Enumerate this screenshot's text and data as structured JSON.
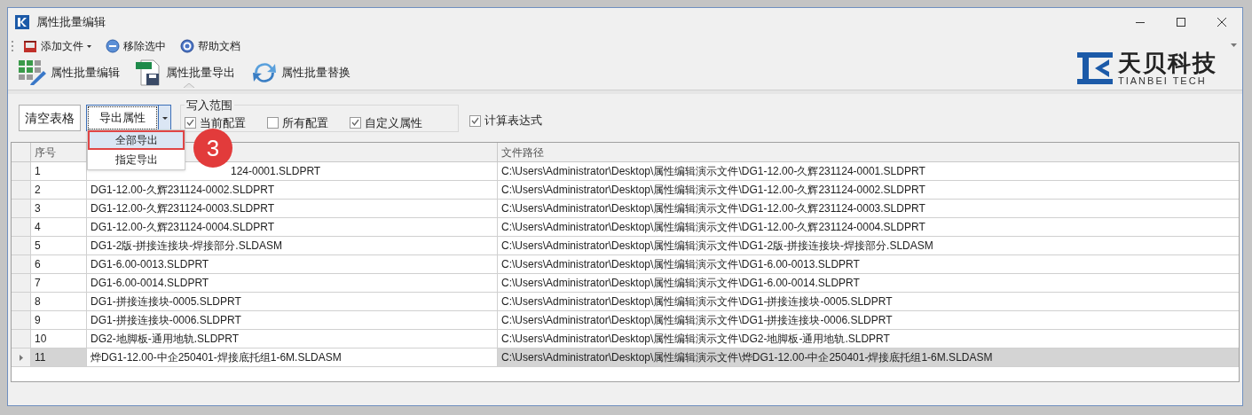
{
  "window": {
    "title": "属性批量编辑"
  },
  "toolbar": [
    {
      "label": "添加文件",
      "kind": "dropdown"
    },
    {
      "label": "移除选中",
      "kind": "remove"
    },
    {
      "label": "帮助文档",
      "kind": "help"
    }
  ],
  "ribbon": [
    {
      "label": "属性批量编辑",
      "kind": "grid",
      "selected": false
    },
    {
      "label": "属性批量导出",
      "kind": "xlsx",
      "selected": true
    },
    {
      "label": "属性批量替换",
      "kind": "refresh",
      "selected": false
    }
  ],
  "logo": {
    "name": "天贝科技",
    "subtitle": "TIANBEI TECH"
  },
  "actions": {
    "clear": "清空表格",
    "export": "导出属性"
  },
  "write_scope": {
    "title": "写入范围",
    "options": [
      {
        "label": "当前配置",
        "checked": true
      },
      {
        "label": "所有配置",
        "checked": false
      },
      {
        "label": "自定义属性",
        "checked": true
      }
    ]
  },
  "compute_expressions": {
    "label": "计算表达式",
    "checked": true
  },
  "export_menu": {
    "items": [
      {
        "label": "全部导出",
        "selected": true
      },
      {
        "label": "指定导出",
        "selected": false
      }
    ],
    "step_badge": "3"
  },
  "table": {
    "columns": [
      "序号",
      "文件路径"
    ],
    "rows": [
      {
        "index": "1",
        "name": "124-0001.SLDPRT",
        "path": "C:\\Users\\Administrator\\Desktop\\属性编辑演示文件\\DG1-12.00-久辉231124-0001.SLDPRT",
        "selected": false
      },
      {
        "index": "2",
        "name": "DG1-12.00-久辉231124-0002.SLDPRT",
        "path": "C:\\Users\\Administrator\\Desktop\\属性编辑演示文件\\DG1-12.00-久辉231124-0002.SLDPRT",
        "selected": false
      },
      {
        "index": "3",
        "name": "DG1-12.00-久辉231124-0003.SLDPRT",
        "path": "C:\\Users\\Administrator\\Desktop\\属性编辑演示文件\\DG1-12.00-久辉231124-0003.SLDPRT",
        "selected": false
      },
      {
        "index": "4",
        "name": "DG1-12.00-久辉231124-0004.SLDPRT",
        "path": "C:\\Users\\Administrator\\Desktop\\属性编辑演示文件\\DG1-12.00-久辉231124-0004.SLDPRT",
        "selected": false
      },
      {
        "index": "5",
        "name": "DG1-2版-拼接连接块-焊接部分.SLDASM",
        "path": "C:\\Users\\Administrator\\Desktop\\属性编辑演示文件\\DG1-2版-拼接连接块-焊接部分.SLDASM",
        "selected": false
      },
      {
        "index": "6",
        "name": "DG1-6.00-0013.SLDPRT",
        "path": "C:\\Users\\Administrator\\Desktop\\属性编辑演示文件\\DG1-6.00-0013.SLDPRT",
        "selected": false
      },
      {
        "index": "7",
        "name": "DG1-6.00-0014.SLDPRT",
        "path": "C:\\Users\\Administrator\\Desktop\\属性编辑演示文件\\DG1-6.00-0014.SLDPRT",
        "selected": false
      },
      {
        "index": "8",
        "name": "DG1-拼接连接块-0005.SLDPRT",
        "path": "C:\\Users\\Administrator\\Desktop\\属性编辑演示文件\\DG1-拼接连接块-0005.SLDPRT",
        "selected": false
      },
      {
        "index": "9",
        "name": "DG1-拼接连接块-0006.SLDPRT",
        "path": "C:\\Users\\Administrator\\Desktop\\属性编辑演示文件\\DG1-拼接连接块-0006.SLDPRT",
        "selected": false
      },
      {
        "index": "10",
        "name": "DG2-地脚板-通用地轨.SLDPRT",
        "path": "C:\\Users\\Administrator\\Desktop\\属性编辑演示文件\\DG2-地脚板-通用地轨.SLDPRT",
        "selected": false
      },
      {
        "index": "11",
        "name": "烨DG1-12.00-中企250401-焊接底托组1-6M.SLDASM",
        "path": "C:\\Users\\Administrator\\Desktop\\属性编辑演示文件\\烨DG1-12.00-中企250401-焊接底托组1-6M.SLDASM",
        "selected": true
      }
    ]
  }
}
